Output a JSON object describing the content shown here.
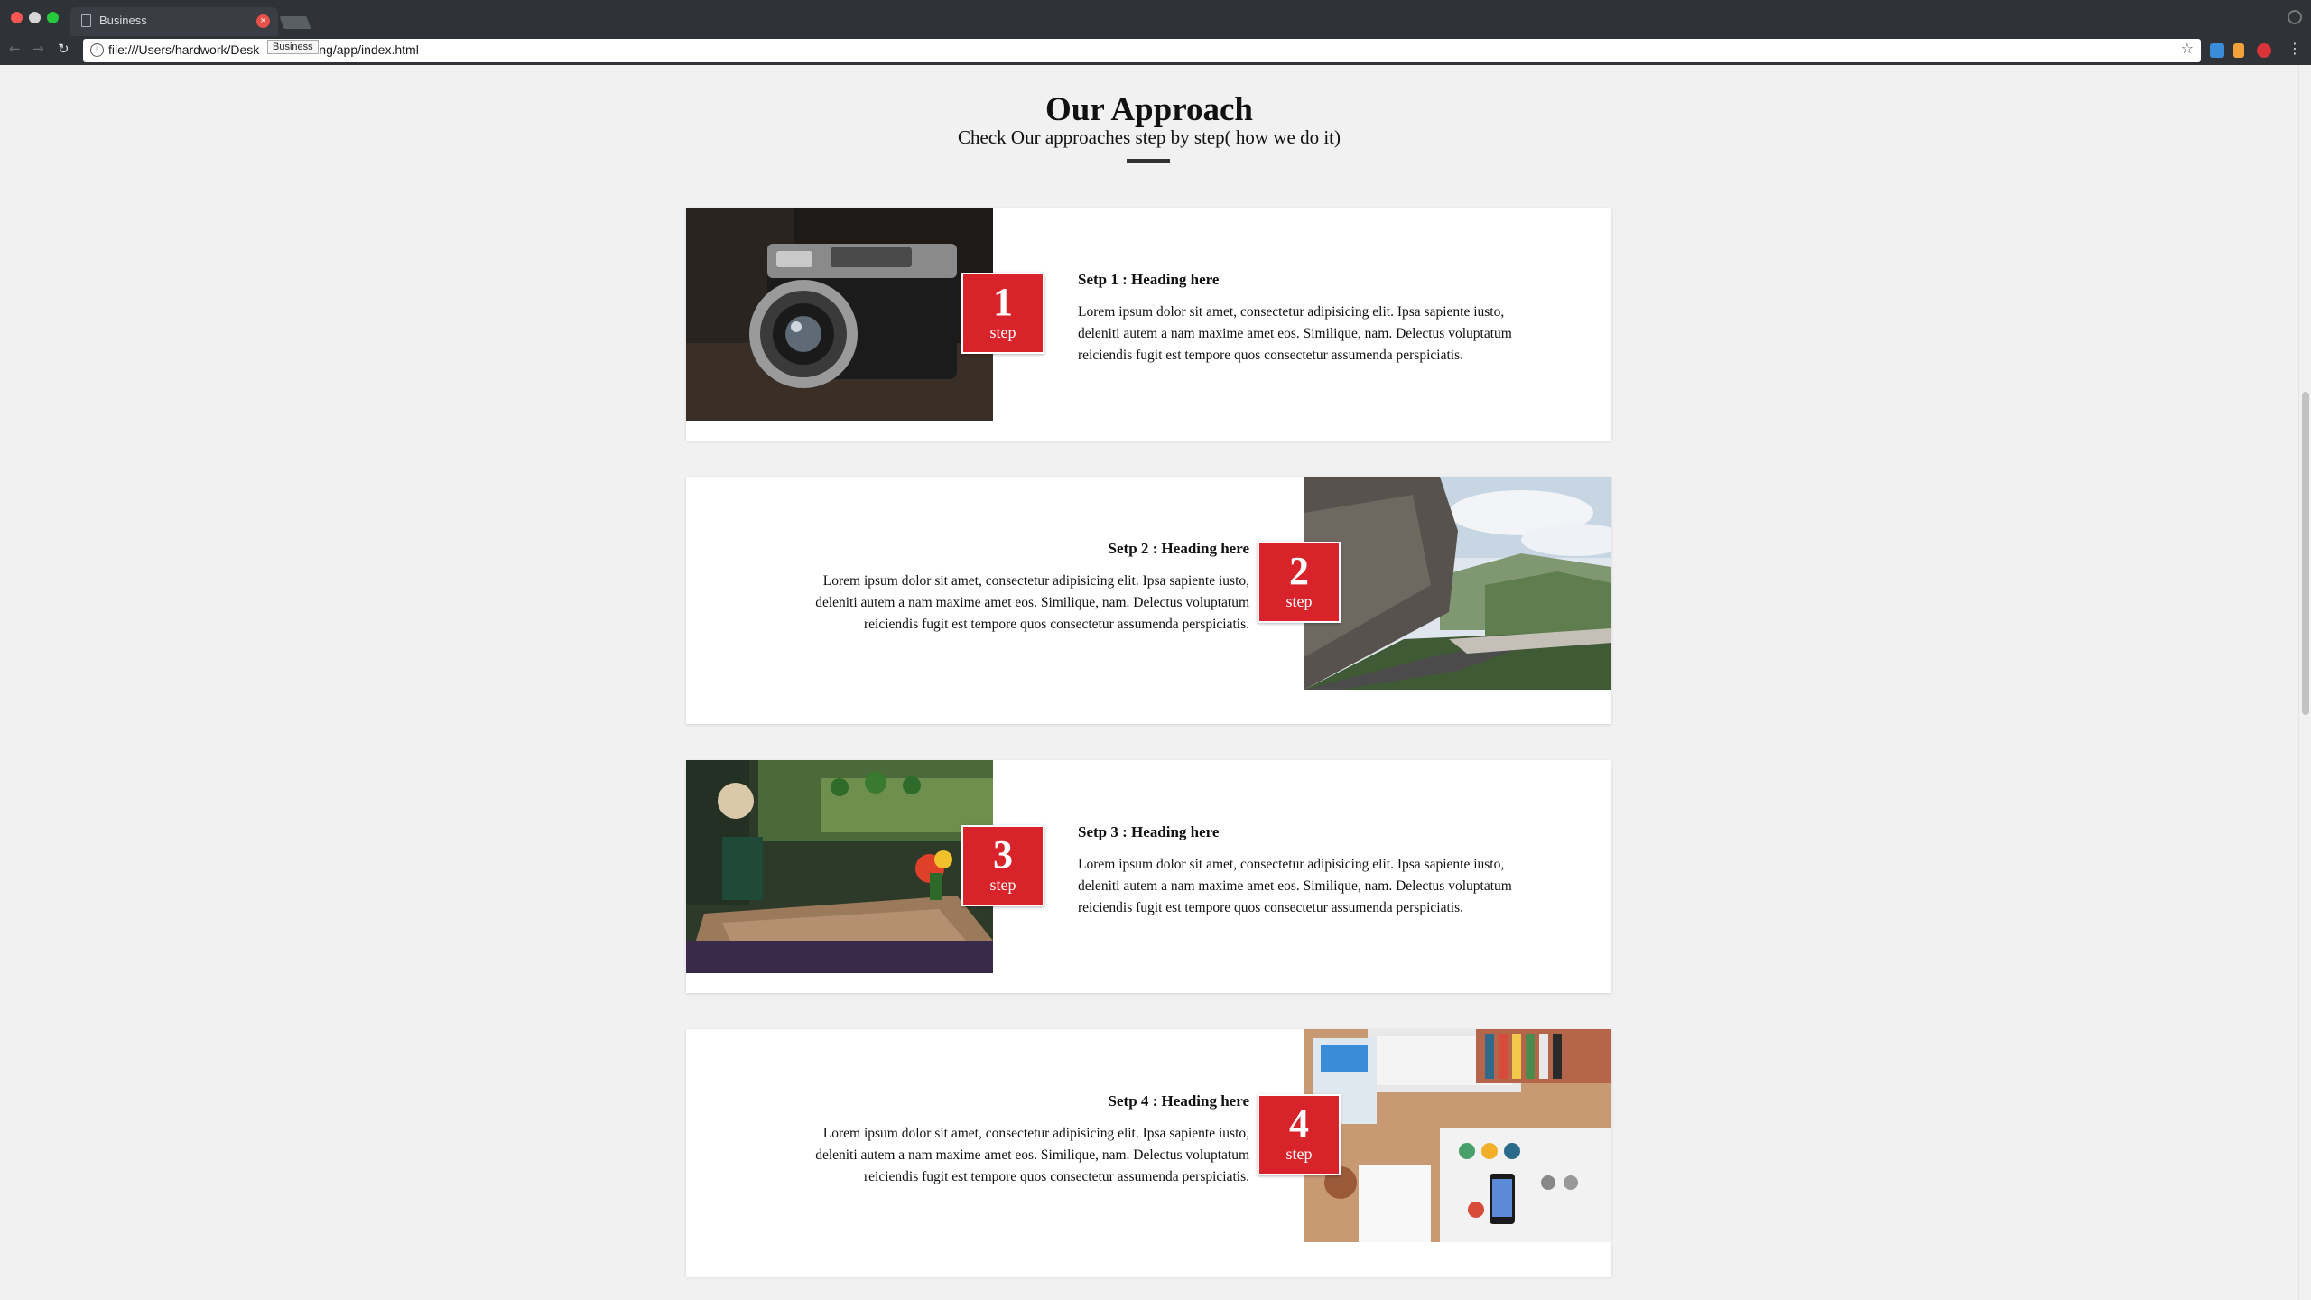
{
  "browser": {
    "tab_title": "Business",
    "tab_close_glyph": "×",
    "tooltip": "Business",
    "url": "file:///Users/hardwork/Desk",
    "url_tail": "ng/app/index.html",
    "icons": [
      "back-arrow-icon",
      "forward-arrow-icon",
      "reload-icon",
      "info-icon",
      "star-icon",
      "menu-dots-icon"
    ]
  },
  "section": {
    "title": "Our Approach",
    "subtitle": "Check Our approaches step by step( how we do it)"
  },
  "colors": {
    "badge": "#d8232a",
    "page_bg": "#f1f1f1",
    "card_bg": "#ffffff"
  },
  "steps": [
    {
      "number": "1",
      "word": "step",
      "heading": "Setp 1 : Heading here",
      "body": "Lorem ipsum dolor sit amet, consectetur adipisicing elit. Ipsa sapiente iusto, deleniti autem a nam maxime amet eos. Similique, nam. Delectus voluptatum reiciendis fugit est tempore quos consectetur assumenda perspiciatis.",
      "image": "camera-photo"
    },
    {
      "number": "2",
      "word": "step",
      "heading": "Setp 2 : Heading here",
      "body": "Lorem ipsum dolor sit amet, consectetur adipisicing elit. Ipsa sapiente iusto, deleniti autem a nam maxime amet eos. Similique, nam. Delectus voluptatum reiciendis fugit est tempore quos consectetur assumenda perspiciatis.",
      "image": "mountain-road-photo"
    },
    {
      "number": "3",
      "word": "step",
      "heading": "Setp 3 : Heading here",
      "body": "Lorem ipsum dolor sit amet, consectetur adipisicing elit. Ipsa sapiente iusto, deleniti autem a nam maxime amet eos. Similique, nam. Delectus voluptatum reiciendis fugit est tempore quos consectetur assumenda perspiciatis.",
      "image": "cafe-table-photo"
    },
    {
      "number": "4",
      "word": "step",
      "heading": "Setp 4 : Heading here",
      "body": "Lorem ipsum dolor sit amet, consectetur adipisicing elit. Ipsa sapiente iusto, deleniti autem a nam maxime amet eos. Similique, nam. Delectus voluptatum reiciendis fugit est tempore quos consectetur assumenda perspiciatis.",
      "image": "desk-workspace-photo"
    }
  ]
}
